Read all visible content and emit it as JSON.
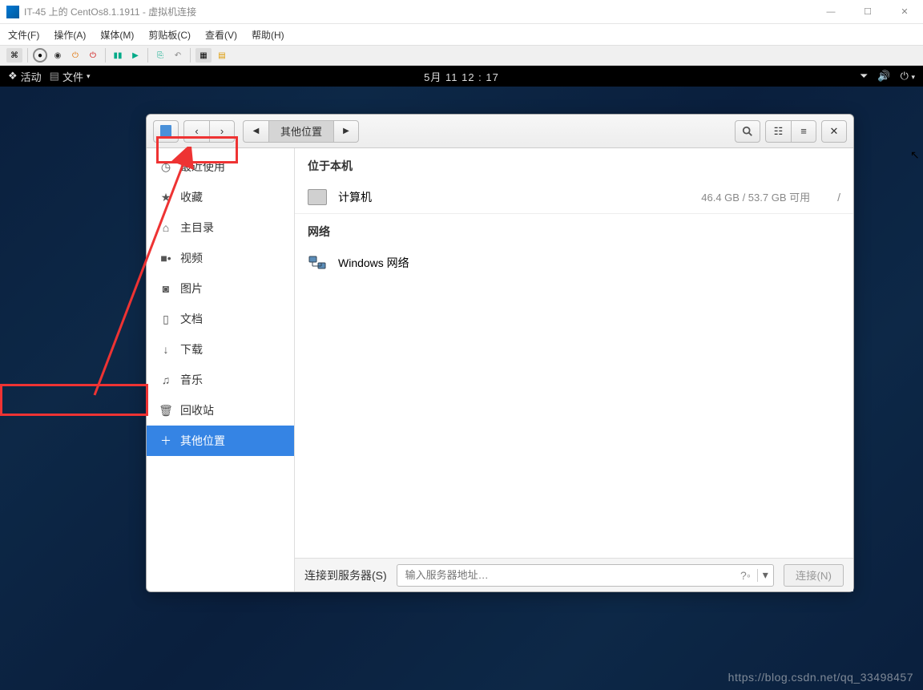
{
  "window": {
    "title": "IT-45 上的 CentOs8.1.1911 - 虚拟机连接"
  },
  "win_menus": [
    "文件(F)",
    "操作(A)",
    "媒体(M)",
    "剪贴板(C)",
    "查看(V)",
    "帮助(H)"
  ],
  "gnome": {
    "activities": "活动",
    "app_menu": "文件",
    "clock": "5月 11 12 : 17"
  },
  "fm": {
    "path_current": "其他位置",
    "sidebar": [
      {
        "icon": "clock",
        "label": "最近使用"
      },
      {
        "icon": "star",
        "label": "收藏"
      },
      {
        "icon": "home",
        "label": "主目录"
      },
      {
        "icon": "video",
        "label": "视频"
      },
      {
        "icon": "camera",
        "label": "图片"
      },
      {
        "icon": "doc",
        "label": "文档"
      },
      {
        "icon": "download",
        "label": "下载"
      },
      {
        "icon": "music",
        "label": "音乐"
      },
      {
        "icon": "trash",
        "label": "回收站"
      },
      {
        "icon": "plus",
        "label": "其他位置",
        "selected": true
      }
    ],
    "sections": {
      "local_header": "位于本机",
      "computer": {
        "label": "计算机",
        "storage": "46.4 GB / 53.7 GB 可用",
        "path": "/"
      },
      "network_header": "网络",
      "windows_network": "Windows 网络"
    },
    "footer": {
      "label": "连接到服务器(S)",
      "placeholder": "输入服务器地址…",
      "connect": "连接(N)"
    }
  },
  "watermark": "https://blog.csdn.net/qq_33498457"
}
